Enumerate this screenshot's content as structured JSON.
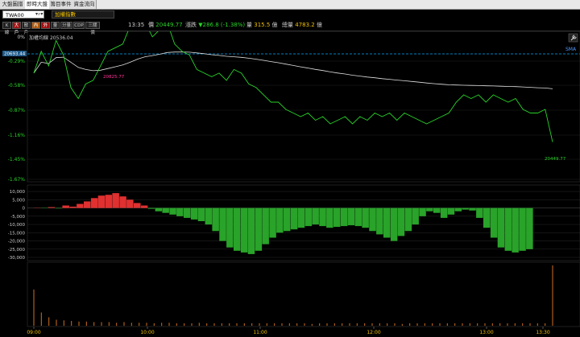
{
  "tabs": [
    {
      "label": "大盤圖譜",
      "active": false
    },
    {
      "label": "即時大盤",
      "active": true
    },
    {
      "label": "籌目事件",
      "active": false
    },
    {
      "label": "資金流向",
      "active": false
    }
  ],
  "symbol": {
    "code": "TWA00",
    "name": "加權指數"
  },
  "toolbar_buttons": [
    {
      "label": "K線",
      "style": "normal"
    },
    {
      "label": "大戶",
      "style": "red"
    },
    {
      "label": "散戶",
      "style": "normal"
    },
    {
      "label": "內",
      "style": "orange"
    },
    {
      "label": "外",
      "style": "red"
    },
    {
      "label": "量",
      "style": "normal"
    },
    {
      "label": "分量",
      "style": "normal"
    },
    {
      "label": "CDP",
      "style": "normal"
    },
    {
      "label": "三關價",
      "style": "normal"
    }
  ],
  "quote": {
    "time": "13:35",
    "price_label": "價",
    "price": "20449.77",
    "change_label": "漲跌",
    "change": "▼286.8 (-1.38%)",
    "volume_label": "量",
    "volume": "315.5",
    "volume_unit": "億",
    "total_label": "總量",
    "total": "4783.2",
    "total_unit": "億"
  },
  "price_panel": {
    "title_label": "加權均線",
    "title_value": "20536.04",
    "ref_value": "20693.44",
    "sma_label": "SMA",
    "high_label": "20825.77",
    "last_label": "20449.77",
    "pct_ticks": [
      "0%",
      "-0.29%",
      "-0.58%",
      "-0.87%",
      "-1.16%",
      "-1.45%",
      "-1.67%"
    ],
    "tool_icon": "wrench-icon"
  },
  "flow_panel": {
    "y_ticks": [
      "10,000",
      "5,000",
      "0",
      "-5,000",
      "-10,000",
      "-15,000",
      "-20,000",
      "-25,000",
      "-30,000"
    ]
  },
  "time_axis": {
    "labels": [
      "09:00",
      "10:00",
      "11:00",
      "12:00",
      "13:00",
      "13:30"
    ]
  },
  "colors": {
    "up": "#e03030",
    "down": "#29d329",
    "ref": "#00aaff",
    "avg": "#e0e0e0",
    "volume": "#d07020",
    "high_label": "#ff3399"
  },
  "chart_data": [
    {
      "type": "line",
      "title": "",
      "series": [
        {
          "name": "",
          "values": [
            20640,
            20700,
            20660,
            20730,
            20690,
            20600,
            20570,
            20610,
            20620,
            20660,
            20700,
            20710,
            20720,
            20770,
            20800,
            20780,
            20740,
            20760,
            20780,
            20720,
            20700,
            20690,
            20650,
            20640,
            20630,
            20640,
            20620,
            20650,
            20640,
            20610,
            20600,
            20580,
            20560,
            20560,
            20540,
            20530,
            20520,
            20530,
            20510,
            20520,
            20500,
            20510,
            20520,
            20500,
            20520,
            20510,
            20530,
            20520,
            20530,
            20510,
            20530,
            20520,
            20510,
            20500,
            20510,
            20520,
            20530,
            20560,
            20580,
            20570,
            20580,
            20560,
            20580,
            20570,
            20560,
            20570,
            20540,
            20530,
            20530,
            20540,
            20450
          ]
        }
      ],
      "ylim": [
        20347,
        20693
      ]
    },
    {
      "type": "area",
      "title": "",
      "values": [
        0,
        -200,
        500,
        -300,
        1500,
        800,
        2500,
        4000,
        6000,
        7500,
        8000,
        9000,
        7000,
        5000,
        3000,
        1500,
        -500,
        -2000,
        -3000,
        -4000,
        -5000,
        -6000,
        -7000,
        -8000,
        -10000,
        -14000,
        -20000,
        -24000,
        -26000,
        -27000,
        -28000,
        -26000,
        -22000,
        -18000,
        -15000,
        -14000,
        -13000,
        -12000,
        -11000,
        -10000,
        -11000,
        -12000,
        -11500,
        -11000,
        -10500,
        -11000,
        -12000,
        -14000,
        -16000,
        -18000,
        -20000,
        -17000,
        -14000,
        -10000,
        -5000,
        -2000,
        -3000,
        -6000,
        -4000,
        -2000,
        -1000,
        -1500,
        -6000,
        -12000,
        -18000,
        -24000,
        -26000,
        -27000,
        -26000,
        -25000
      ],
      "ylim": [
        -30000,
        12000
      ]
    },
    {
      "type": "bar",
      "title": "",
      "values": [
        60,
        22,
        14,
        10,
        9,
        8,
        7,
        7,
        6,
        6,
        6,
        5,
        6,
        5,
        5,
        5,
        4,
        5,
        5,
        4,
        4,
        4,
        5,
        4,
        4,
        4,
        4,
        4,
        4,
        4,
        4,
        4,
        4,
        4,
        4,
        4,
        4,
        3,
        4,
        4,
        4,
        4,
        4,
        4,
        4,
        4,
        4,
        4,
        4,
        3,
        4,
        4,
        4,
        4,
        4,
        4,
        4,
        4,
        4,
        4,
        4,
        4,
        4,
        4,
        4,
        4,
        4,
        4,
        4,
        100
      ]
    }
  ]
}
